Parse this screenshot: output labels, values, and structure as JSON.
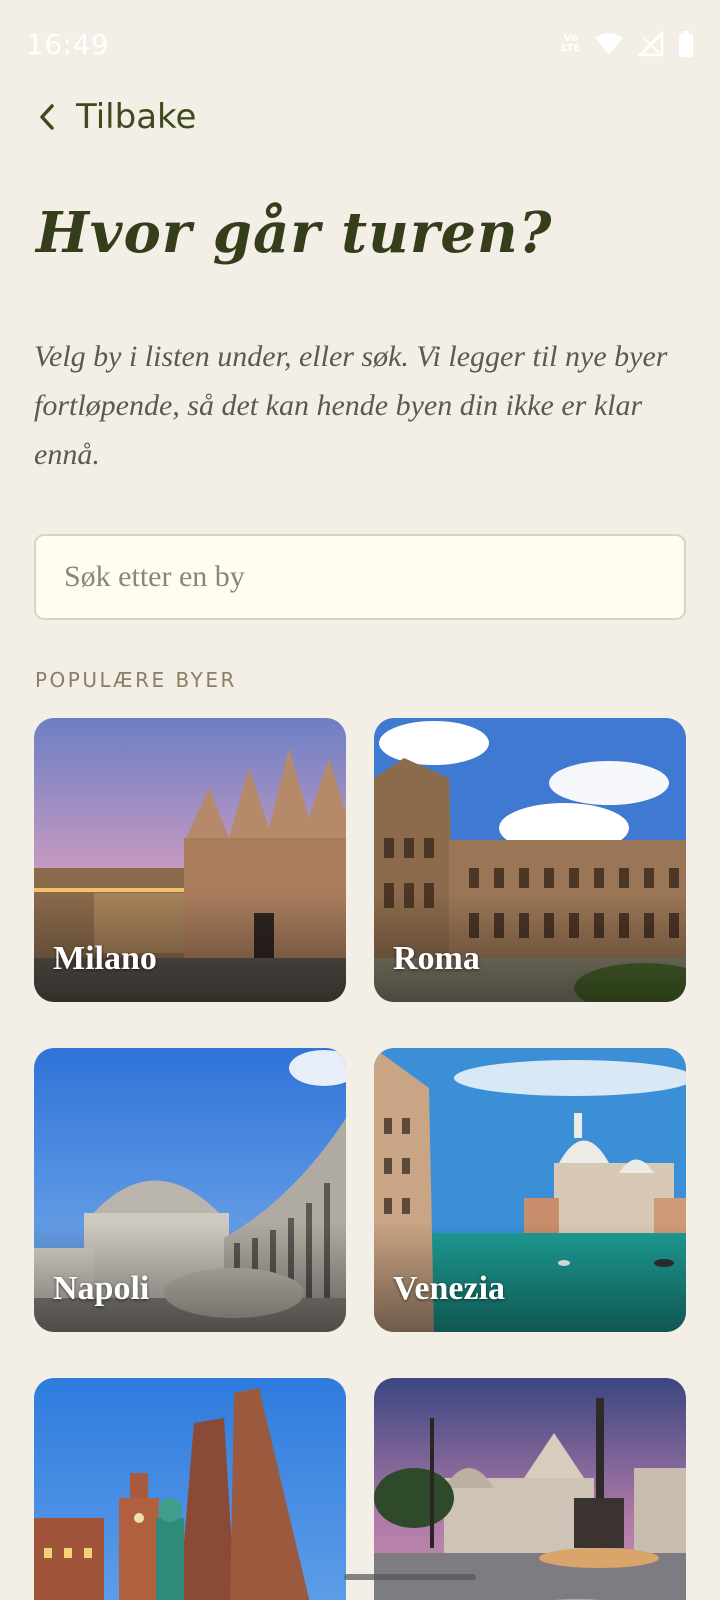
{
  "status": {
    "time": "16:49",
    "network_label": "VoLTE"
  },
  "nav": {
    "back_label": "Tilbake"
  },
  "page": {
    "title": "Hvor går turen?",
    "intro": "Velg by i listen under, eller søk. Vi legger til nye byer fortløpende, så det kan hende byen din ikke er klar ennå."
  },
  "search": {
    "placeholder": "Søk etter en by",
    "value": ""
  },
  "popular": {
    "label": "POPULÆRE BYER",
    "cities": [
      {
        "name": "Milano"
      },
      {
        "name": "Roma"
      },
      {
        "name": "Napoli"
      },
      {
        "name": "Venezia"
      },
      {
        "name": ""
      },
      {
        "name": ""
      }
    ]
  },
  "colors": {
    "background": "#f4efe6",
    "title": "#353d1a",
    "accent": "#3f4a1f"
  },
  "icons": {
    "back": "chevron-left-icon",
    "wifi": "wifi-icon",
    "signal": "signal-icon",
    "battery": "battery-icon"
  }
}
